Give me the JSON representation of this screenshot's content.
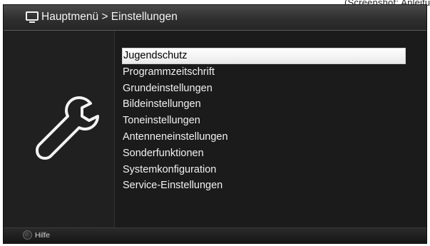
{
  "top_right_cut_text": "(Screenshot: Anleitung)",
  "header": {
    "title": "Hauptmenü > Einstellungen",
    "icon": "tv-icon"
  },
  "sidebar": {
    "icon": "wrench-icon"
  },
  "menu": {
    "items": [
      {
        "label": "Jugendschutz",
        "selected": true
      },
      {
        "label": "Programmzeitschrift"
      },
      {
        "label": "Grundeinstellungen"
      },
      {
        "label": "Bildeinstellungen"
      },
      {
        "label": "Toneinstellungen"
      },
      {
        "label": "Antenneneinstellungen"
      },
      {
        "label": "Sonderfunktionen"
      },
      {
        "label": "Systemkonfiguration"
      },
      {
        "label": "Service-Einstellungen"
      }
    ]
  },
  "footer": {
    "help_label": "Hilfe",
    "help_button_color": "#1a1a1a"
  },
  "colors": {
    "background": "#1b1b1b",
    "selected_item": "#ffffff",
    "text": "#f1f1f1"
  }
}
